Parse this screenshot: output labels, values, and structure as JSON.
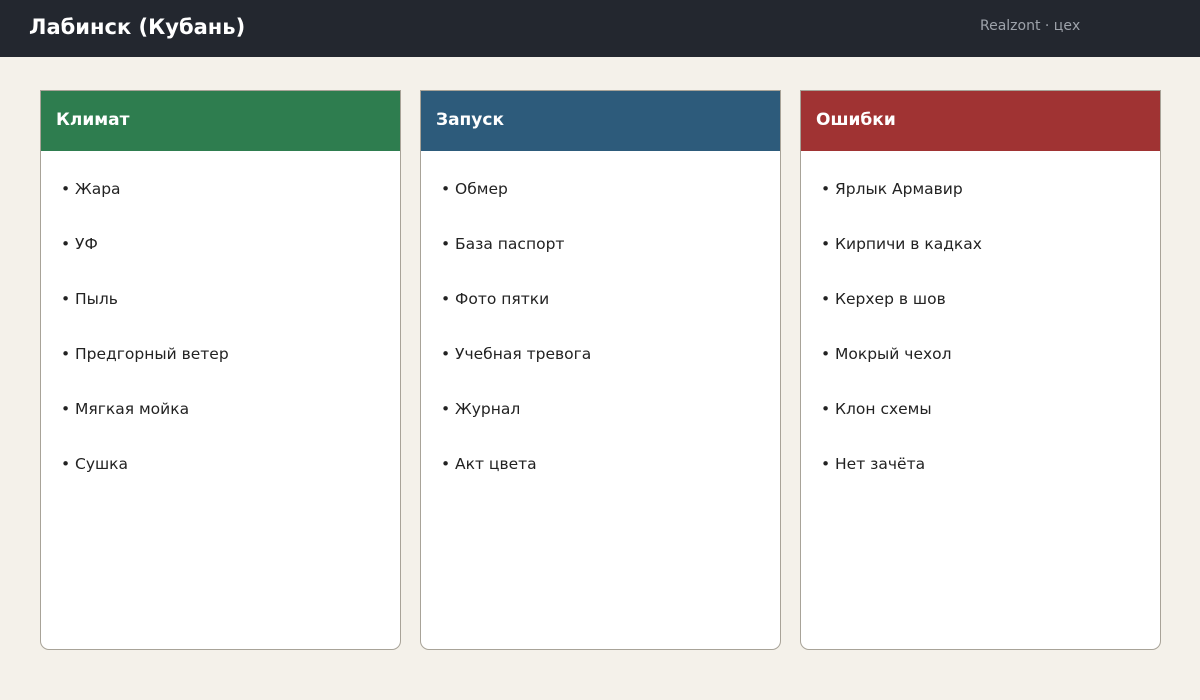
{
  "header": {
    "title": "Лабинск (Кубань)",
    "brand": "Realzont · цех"
  },
  "bullet": "•",
  "cards": [
    {
      "title": "Климат",
      "color": "#2e7d4f",
      "items": [
        "Жара",
        "УФ",
        "Пыль",
        "Предгорный ветер",
        "Мягкая мойка",
        "Сушка"
      ]
    },
    {
      "title": "Запуск",
      "color": "#2d5b7b",
      "items": [
        "Обмер",
        "База паспорт",
        "Фото пятки",
        "Учебная тревога",
        "Журнал",
        "Акт цвета"
      ]
    },
    {
      "title": "Ошибки",
      "color": "#a03333",
      "items": [
        "Ярлык Армавир",
        "Кирпичи в кадках",
        "Керхер в шов",
        "Мокрый чехол",
        "Клон схемы",
        "Нет зачёта"
      ]
    }
  ]
}
